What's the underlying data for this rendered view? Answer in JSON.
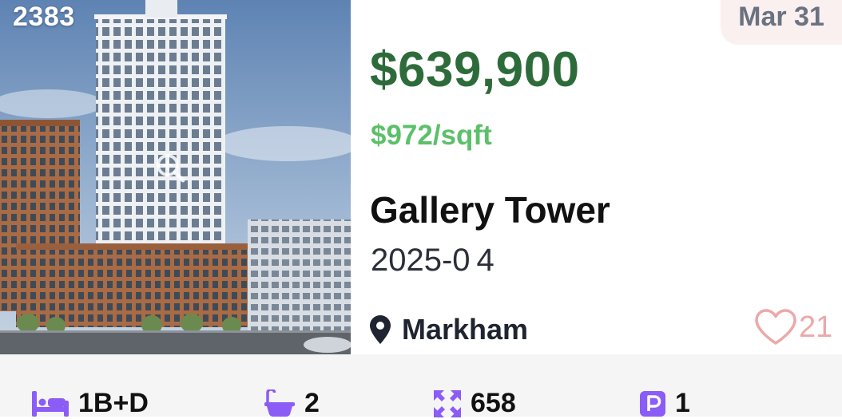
{
  "listing": {
    "photo_id": "2383",
    "date": "Mar 31",
    "price": "$639,900",
    "price_per_sqft": "$972/sqft",
    "name": "Gallery Tower",
    "occupancy": "2025-0 4",
    "location": "Markham",
    "favorites": "21"
  },
  "specs": {
    "bedrooms": "1B+D",
    "bathrooms": "2",
    "size": "658",
    "parking": "1"
  },
  "colors": {
    "price": "#2e6b3a",
    "price_per_sqft": "#5cc06a",
    "icons": "#8b5cf6",
    "heart": "#eca8a8",
    "badge_bg": "#fbf0f0"
  },
  "icons": {
    "location": "map-pin-icon",
    "favorite": "heart-outline-icon",
    "bed": "bed-icon",
    "bath": "bathtub-icon",
    "size": "expand-arrows-icon",
    "parking": "parking-icon",
    "zoom": "zoom-icon"
  }
}
